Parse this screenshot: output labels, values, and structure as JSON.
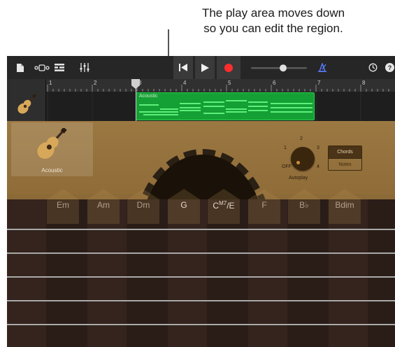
{
  "callout": {
    "line1": "The play area moves down",
    "line2": "so you can edit the region."
  },
  "toolbar": {
    "icons": [
      "document-icon",
      "view-toggle-icon",
      "tracks-icon",
      "mixer-icon",
      "rewind-icon",
      "play-icon",
      "record-icon",
      "volume-slider",
      "metronome-icon",
      "settings-icon",
      "help-icon"
    ],
    "colors": {
      "record": "#ff2d2d",
      "metronome": "#5a7cff"
    }
  },
  "timeline": {
    "bars": [
      "1",
      "2",
      "3",
      "4",
      "5",
      "6",
      "7",
      "8"
    ],
    "region_label": "Acoustic"
  },
  "instrument": {
    "name": "Acoustic",
    "autoplay_label": "Autoplay",
    "autoplay_positions": [
      "OFF",
      "1",
      "2",
      "3",
      "4"
    ],
    "mode_buttons": [
      "Chords",
      "Notes"
    ],
    "active_mode": "Chords"
  },
  "chords": [
    {
      "label": "Em"
    },
    {
      "label": "Am"
    },
    {
      "label": "Dm"
    },
    {
      "label": "G"
    },
    {
      "label": "C",
      "sup": "M7",
      "suffix": "/E"
    },
    {
      "label": "F"
    },
    {
      "label": "B♭"
    },
    {
      "label": "Bdim"
    }
  ]
}
